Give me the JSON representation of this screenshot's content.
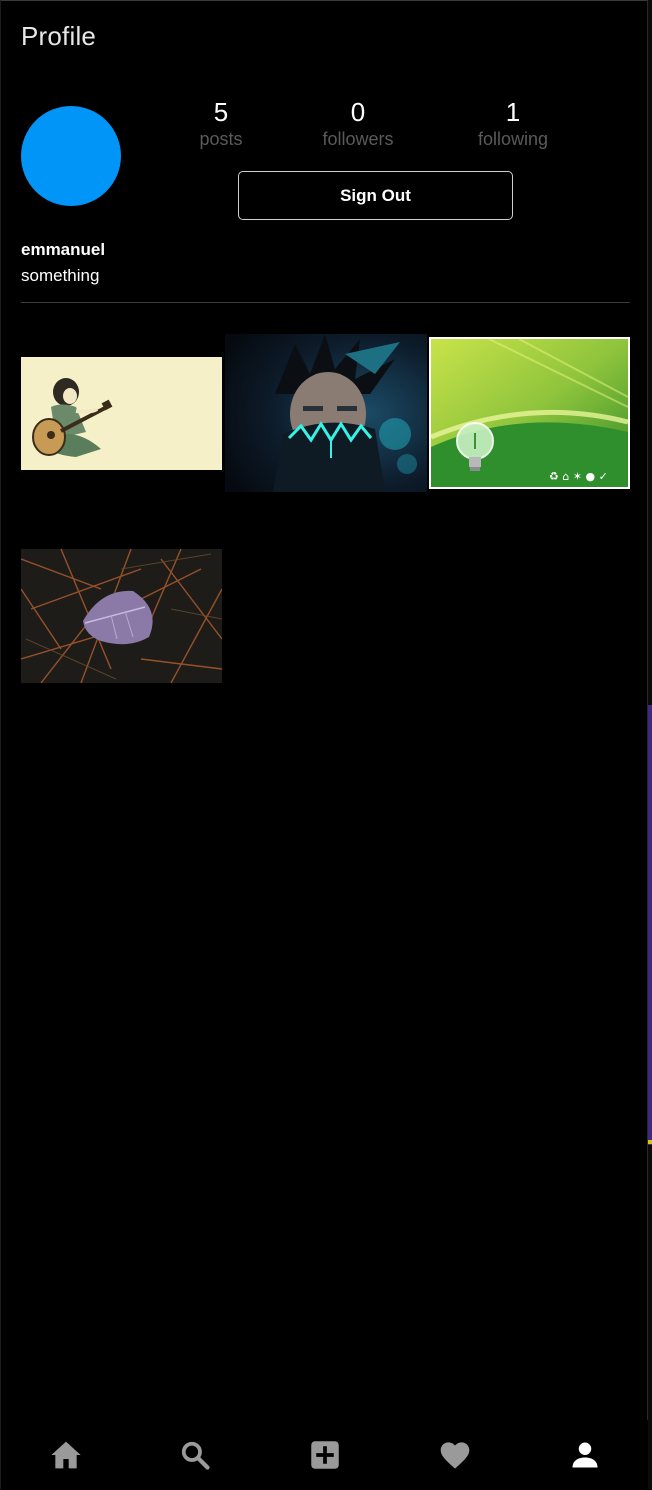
{
  "header": {
    "title": "Profile"
  },
  "profile": {
    "username": "emmanuel",
    "bio": "something",
    "avatar_color": "#0095f6",
    "stats": {
      "posts": {
        "value": "5",
        "label": "posts"
      },
      "followers": {
        "value": "0",
        "label": "followers"
      },
      "following": {
        "value": "1",
        "label": "following"
      }
    },
    "sign_out_label": "Sign Out"
  },
  "posts": [
    {
      "subject": "person playing guitar illustration"
    },
    {
      "subject": "masked anime character with glowing teeth"
    },
    {
      "subject": "green light bulb eco graphic"
    },
    {
      "subject": "purple leaf on pine needles"
    }
  ],
  "bottom_nav": {
    "items": [
      {
        "icon": "home-icon",
        "color": "#9a9a9a"
      },
      {
        "icon": "search-icon",
        "color": "#9a9a9a"
      },
      {
        "icon": "add-box-icon",
        "color": "#9a9a9a"
      },
      {
        "icon": "heart-icon",
        "color": "#9a9a9a"
      },
      {
        "icon": "profile-icon",
        "color": "#ffffff"
      }
    ]
  },
  "theme": {
    "background": "#000000",
    "muted_text": "#5a5a5a",
    "accent": "#0095f6"
  }
}
